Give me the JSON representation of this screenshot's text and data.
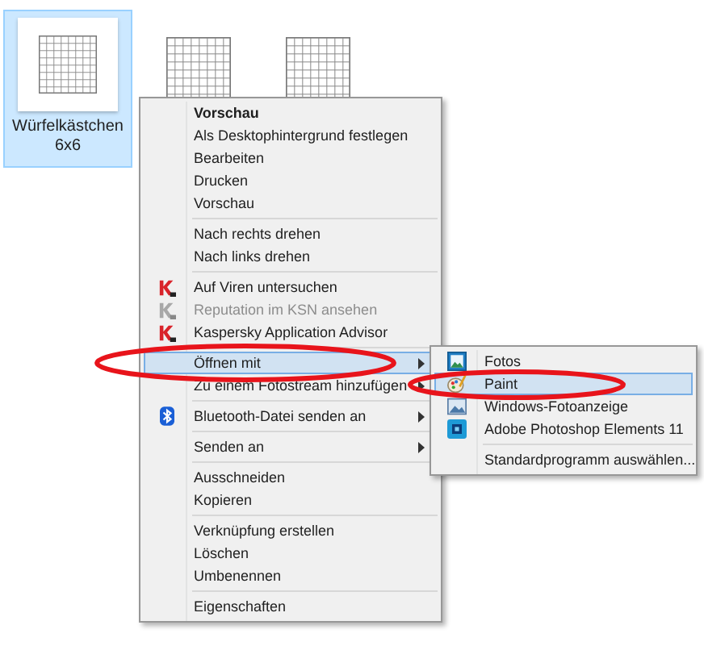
{
  "files": [
    {
      "label": "Würfelkästchen 6x6",
      "selected": true
    },
    {
      "selected": false
    },
    {
      "selected": false
    }
  ],
  "context_menu": {
    "groups": [
      [
        {
          "label": "Vorschau",
          "kind": "plain",
          "default": true,
          "selected": false,
          "disabled": false,
          "circled": false,
          "submenu": false
        },
        {
          "label": "Als Desktophintergrund festlegen",
          "kind": "plain",
          "default": false,
          "selected": false,
          "disabled": false,
          "circled": false,
          "submenu": false
        },
        {
          "label": "Bearbeiten",
          "kind": "plain",
          "default": false,
          "selected": false,
          "disabled": false,
          "circled": false,
          "submenu": false
        },
        {
          "label": "Drucken",
          "kind": "plain",
          "default": false,
          "selected": false,
          "disabled": false,
          "circled": false,
          "submenu": false
        },
        {
          "label": "Vorschau",
          "kind": "plain",
          "default": false,
          "selected": false,
          "disabled": false,
          "circled": false,
          "submenu": false
        }
      ],
      [
        {
          "label": "Nach rechts drehen",
          "kind": "plain",
          "default": false,
          "selected": false,
          "disabled": false,
          "circled": false,
          "submenu": false
        },
        {
          "label": "Nach links drehen",
          "kind": "plain",
          "default": false,
          "selected": false,
          "disabled": false,
          "circled": false,
          "submenu": false
        }
      ],
      [
        {
          "label": "Auf Viren untersuchen",
          "kind": "antivirus",
          "default": false,
          "selected": false,
          "disabled": false,
          "circled": false,
          "submenu": false
        },
        {
          "label": "Reputation im KSN ansehen",
          "kind": "antivirus",
          "default": false,
          "selected": false,
          "disabled": true,
          "circled": false,
          "submenu": false
        },
        {
          "label": "Kaspersky Application Advisor",
          "kind": "antivirus",
          "default": false,
          "selected": false,
          "disabled": false,
          "circled": false,
          "submenu": false
        }
      ],
      [
        {
          "label": "Öffnen mit",
          "kind": "plain",
          "default": false,
          "selected": true,
          "disabled": false,
          "circled": true,
          "submenu": true
        },
        {
          "label": "Zu einem Fotostream hinzufügen",
          "kind": "plain",
          "default": false,
          "selected": false,
          "disabled": false,
          "circled": false,
          "submenu": true
        }
      ],
      [
        {
          "label": "Bluetooth-Datei senden an",
          "kind": "bluetooth",
          "default": false,
          "selected": false,
          "disabled": false,
          "circled": false,
          "submenu": true
        }
      ],
      [
        {
          "label": "Senden an",
          "kind": "plain",
          "default": false,
          "selected": false,
          "disabled": false,
          "circled": false,
          "submenu": true
        }
      ],
      [
        {
          "label": "Ausschneiden",
          "kind": "plain",
          "default": false,
          "selected": false,
          "disabled": false,
          "circled": false,
          "submenu": false
        },
        {
          "label": "Kopieren",
          "kind": "plain",
          "default": false,
          "selected": false,
          "disabled": false,
          "circled": false,
          "submenu": false
        }
      ],
      [
        {
          "label": "Verknüpfung erstellen",
          "kind": "plain",
          "default": false,
          "selected": false,
          "disabled": false,
          "circled": false,
          "submenu": false
        },
        {
          "label": "Löschen",
          "kind": "plain",
          "default": false,
          "selected": false,
          "disabled": false,
          "circled": false,
          "submenu": false
        },
        {
          "label": "Umbenennen",
          "kind": "plain",
          "default": false,
          "selected": false,
          "disabled": false,
          "circled": false,
          "submenu": false
        }
      ],
      [
        {
          "label": "Eigenschaften",
          "kind": "plain",
          "default": false,
          "selected": false,
          "disabled": false,
          "circled": false,
          "submenu": false
        }
      ]
    ]
  },
  "open_with_submenu": {
    "groups": [
      [
        {
          "label": "Fotos",
          "kind": "photos",
          "selected": false,
          "circled": false
        },
        {
          "label": "Paint",
          "kind": "paint",
          "selected": true,
          "circled": true
        },
        {
          "label": "Windows-Fotoanzeige",
          "kind": "viewer",
          "selected": false,
          "circled": false
        },
        {
          "label": "Adobe Photoshop Elements 11",
          "kind": "editor",
          "selected": false,
          "circled": false
        }
      ],
      [
        {
          "label": "Standardprogramm auswählen...",
          "kind": "plain",
          "selected": false,
          "circled": false
        }
      ]
    ]
  }
}
